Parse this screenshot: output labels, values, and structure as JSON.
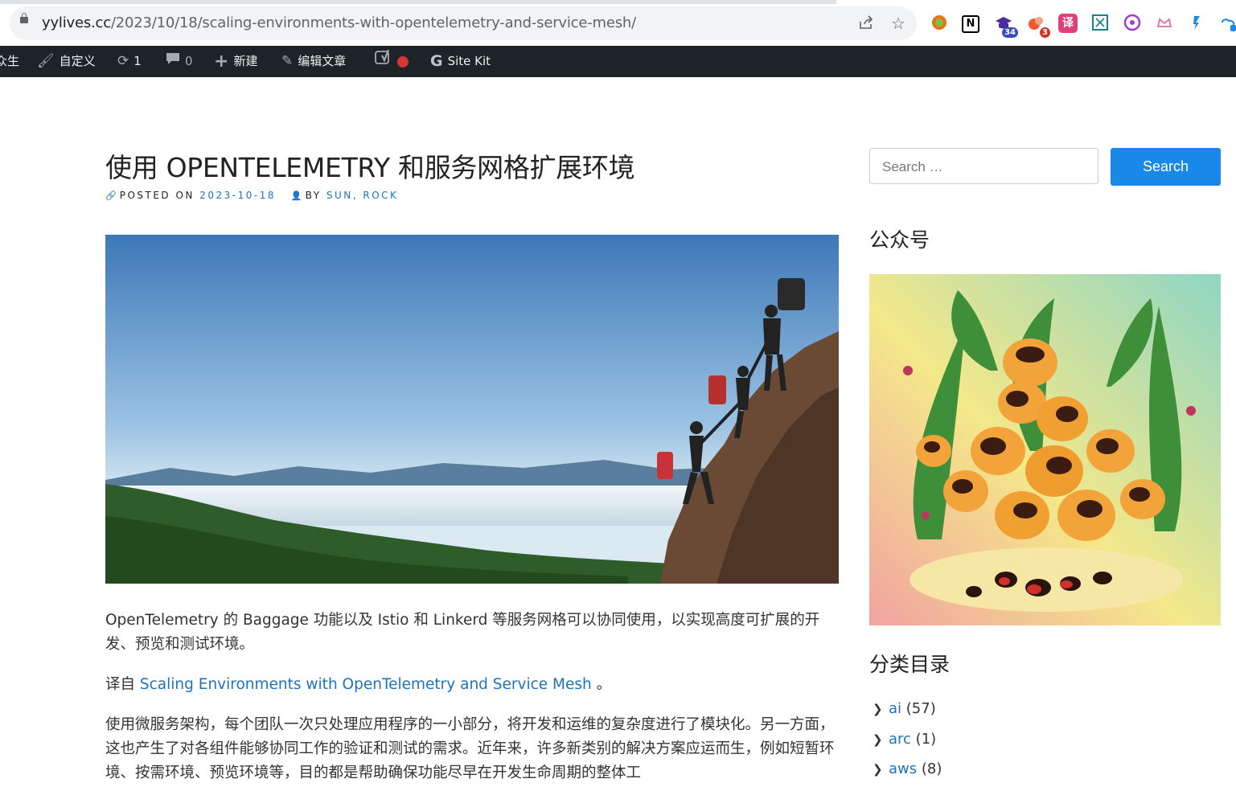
{
  "browser": {
    "url_host": "yylives.cc",
    "url_path": "/2023/10/18/scaling-environments-with-opentelemetry-and-service-mesh/",
    "share_icon": "share-icon",
    "bookmark_icon": "star-icon",
    "extensions": [
      {
        "name": "chrome-circle-extension-icon",
        "badge": ""
      },
      {
        "name": "notion-extension-icon",
        "label": "N",
        "badge": ""
      },
      {
        "name": "graduation-cap-extension-icon",
        "badge": "34"
      },
      {
        "name": "blob-extension-icon",
        "badge": "3"
      },
      {
        "name": "translate-extension-icon",
        "label": "译",
        "badge": ""
      },
      {
        "name": "dictionary-extension-icon",
        "badge": ""
      },
      {
        "name": "purple-extension-icon",
        "badge": ""
      },
      {
        "name": "crown-extension-icon",
        "badge": ""
      },
      {
        "name": "feather-extension-icon",
        "badge": ""
      }
    ]
  },
  "adminbar": {
    "site_label": "众生",
    "customize_label": "自定义",
    "updates_count": "1",
    "comments_count": "0",
    "new_label": "新建",
    "edit_label": "编辑文章",
    "sitekit_label": "Site Kit"
  },
  "post": {
    "title": "使用 OPENTELEMETRY 和服务网格扩展环境",
    "posted_on_label": "POSTED ON",
    "date": "2023-10-18",
    "by_label": "BY",
    "authors": "SUN, ROCK",
    "paragraph1": "OpenTelemetry 的 Baggage 功能以及 Istio 和 Linkerd 等服务网格可以协同使用，以实现高度可扩展的开发、预览和测试环境。",
    "translated_prefix": "译自 ",
    "translated_link": "Scaling Environments with OpenTelemetry and Service Mesh",
    "translated_suffix": " 。",
    "paragraph3": "使用微服务架构，每个团队一次只处理应用程序的一小部分，将开发和运维的复杂度进行了模块化。另一方面，这也产生了对各组件能够协同工作的验证和测试的需求。近年来，许多新类别的解决方案应运而生，例如短暂环境、按需环境、预览环境等，目的都是帮助确保功能尽早在开发生命周期的整体工"
  },
  "sidebar": {
    "search_placeholder": "Search …",
    "search_button": "Search",
    "wechat_title": "公众号",
    "categories_title": "分类目录",
    "categories": [
      {
        "name": "ai",
        "count": "(57)"
      },
      {
        "name": "arc",
        "count": "(1)"
      },
      {
        "name": "aws",
        "count": "(8)"
      }
    ]
  }
}
